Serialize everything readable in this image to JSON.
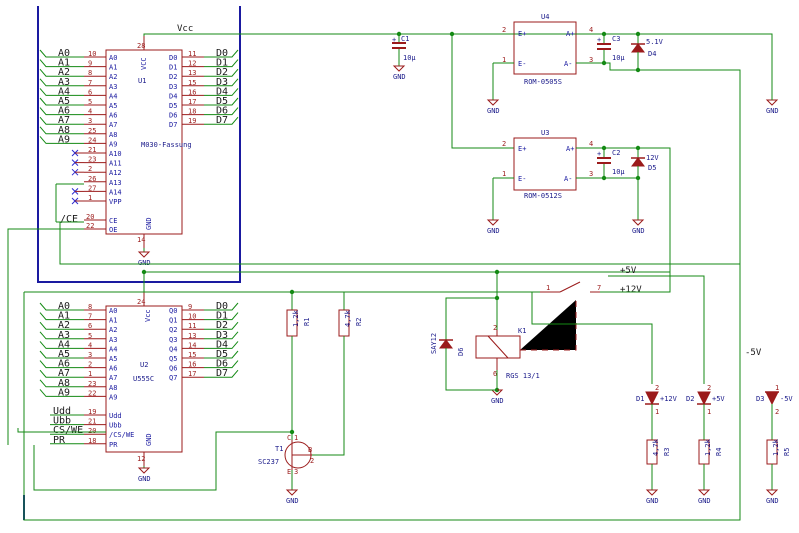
{
  "rails": {
    "vcc": "Vcc",
    "plus5": "+5V",
    "plus12": "+12V",
    "minus5": "-5V"
  },
  "gnd_label": "GND",
  "u1": {
    "ref": "U1",
    "value": "M030-Fassung",
    "vcc_label": "VCC",
    "vcc_pin": "28",
    "gnd_label": "GND",
    "gnd_pin": "14",
    "addr": [
      {
        "net": "A0",
        "pin": "10",
        "lbl": "A0"
      },
      {
        "net": "A1",
        "pin": "9",
        "lbl": "A1"
      },
      {
        "net": "A2",
        "pin": "8",
        "lbl": "A2"
      },
      {
        "net": "A3",
        "pin": "7",
        "lbl": "A3"
      },
      {
        "net": "A4",
        "pin": "6",
        "lbl": "A4"
      },
      {
        "net": "A5",
        "pin": "5",
        "lbl": "A5"
      },
      {
        "net": "A6",
        "pin": "4",
        "lbl": "A6"
      },
      {
        "net": "A7",
        "pin": "3",
        "lbl": "A7"
      },
      {
        "net": "A8",
        "pin": "25",
        "lbl": "A8"
      },
      {
        "net": "A9",
        "pin": "24",
        "lbl": "A9"
      }
    ],
    "upper": [
      {
        "pin": "21",
        "lbl": "A10"
      },
      {
        "pin": "23",
        "lbl": "A11"
      },
      {
        "pin": "2",
        "lbl": "A12"
      },
      {
        "pin": "26",
        "lbl": "A13"
      },
      {
        "pin": "27",
        "lbl": "A14"
      },
      {
        "pin": "1",
        "lbl": "VPP"
      }
    ],
    "ce": {
      "net": "/CE",
      "pin": "20",
      "lbl": "CE"
    },
    "oe": {
      "pin": "22",
      "lbl": "OE"
    },
    "data": [
      {
        "net": "D0",
        "pin": "11",
        "lbl": "D0"
      },
      {
        "net": "D1",
        "pin": "12",
        "lbl": "D1"
      },
      {
        "net": "D2",
        "pin": "13",
        "lbl": "D2"
      },
      {
        "net": "D3",
        "pin": "15",
        "lbl": "D3"
      },
      {
        "net": "D4",
        "pin": "16",
        "lbl": "D4"
      },
      {
        "net": "D5",
        "pin": "17",
        "lbl": "D5"
      },
      {
        "net": "D6",
        "pin": "18",
        "lbl": "D6"
      },
      {
        "net": "D7",
        "pin": "19",
        "lbl": "D7"
      }
    ]
  },
  "u2": {
    "ref": "U2",
    "value": "U555C",
    "vcc_label": "Vcc",
    "vcc_pin": "24",
    "gnd_label": "GND",
    "gnd_pin": "12",
    "addr": [
      {
        "net": "A0",
        "pin": "8",
        "lbl": "A0"
      },
      {
        "net": "A1",
        "pin": "7",
        "lbl": "A1"
      },
      {
        "net": "A2",
        "pin": "6",
        "lbl": "A2"
      },
      {
        "net": "A3",
        "pin": "5",
        "lbl": "A3"
      },
      {
        "net": "A4",
        "pin": "4",
        "lbl": "A4"
      },
      {
        "net": "A5",
        "pin": "3",
        "lbl": "A5"
      },
      {
        "net": "A6",
        "pin": "2",
        "lbl": "A6"
      },
      {
        "net": "A7",
        "pin": "1",
        "lbl": "A7"
      },
      {
        "net": "A8",
        "pin": "23",
        "lbl": "A8"
      },
      {
        "net": "A9",
        "pin": "22",
        "lbl": "A9"
      }
    ],
    "data": [
      {
        "net": "D0",
        "pin": "9",
        "lbl": "Q0"
      },
      {
        "net": "D1",
        "pin": "10",
        "lbl": "Q1"
      },
      {
        "net": "D2",
        "pin": "11",
        "lbl": "Q2"
      },
      {
        "net": "D3",
        "pin": "13",
        "lbl": "Q3"
      },
      {
        "net": "D4",
        "pin": "14",
        "lbl": "Q4"
      },
      {
        "net": "D5",
        "pin": "15",
        "lbl": "Q5"
      },
      {
        "net": "D6",
        "pin": "16",
        "lbl": "Q6"
      },
      {
        "net": "D7",
        "pin": "17",
        "lbl": "Q7"
      }
    ],
    "ctrl": [
      {
        "net": "Udd",
        "pin": "19",
        "lbl": "Udd"
      },
      {
        "net": "Ubb",
        "pin": "21",
        "lbl": "Ubb"
      },
      {
        "net": "CS/WE",
        "pin": "20",
        "lbl": "/CS/WE"
      },
      {
        "net": "PR",
        "pin": "18",
        "lbl": "PR"
      }
    ]
  },
  "u4": {
    "ref": "U4",
    "value": "ROM-0505S",
    "ep": "E+",
    "em": "E-",
    "ap": "A+",
    "am": "A-",
    "p1": "2",
    "p2": "1",
    "p3": "4",
    "p4": "3"
  },
  "u3": {
    "ref": "U3",
    "value": "ROM-0512S",
    "ep": "E+",
    "em": "E-",
    "ap": "A+",
    "am": "A-",
    "p1": "2",
    "p2": "1",
    "p3": "4",
    "p4": "3"
  },
  "c1": {
    "ref": "C1",
    "value": "10µ",
    "plus": "+"
  },
  "c3": {
    "ref": "C3",
    "value": "10µ",
    "plus": "+"
  },
  "c2": {
    "ref": "C2",
    "value": "10µ",
    "plus": "+"
  },
  "d4": {
    "ref": "D4",
    "value": "5.1V"
  },
  "d5": {
    "ref": "D5",
    "value": "12V"
  },
  "d6": {
    "ref": "D6",
    "value": "SAY12"
  },
  "k1": {
    "ref": "K1",
    "value": "RGS 13/1",
    "p2": "2",
    "p6": "6",
    "p1": "1",
    "p7": "7"
  },
  "r1": {
    "ref": "R1",
    "value": "1,2k"
  },
  "r2": {
    "ref": "R2",
    "value": "4,7k"
  },
  "r3": {
    "ref": "R3",
    "value": "4,7k"
  },
  "r4": {
    "ref": "R4",
    "value": "1,2k"
  },
  "r5": {
    "ref": "R5",
    "value": "1,2k"
  },
  "d1": {
    "ref": "D1",
    "value": "+12V",
    "p1": "1",
    "p2": "2"
  },
  "d2": {
    "ref": "D2",
    "value": "+5V",
    "p1": "1",
    "p2": "2"
  },
  "d3": {
    "ref": "D3",
    "value": "-5V",
    "p1": "1",
    "p2": "2"
  },
  "t1": {
    "ref": "T1",
    "value": "SC237",
    "c": "C",
    "b": "B",
    "e": "E",
    "p1": "1",
    "p2": "2",
    "p3": "3"
  },
  "colors": {
    "wire": "#148a14",
    "bus": "#1a1aa0",
    "part": "#9b1b1b",
    "nc": "#2a2ad0"
  }
}
